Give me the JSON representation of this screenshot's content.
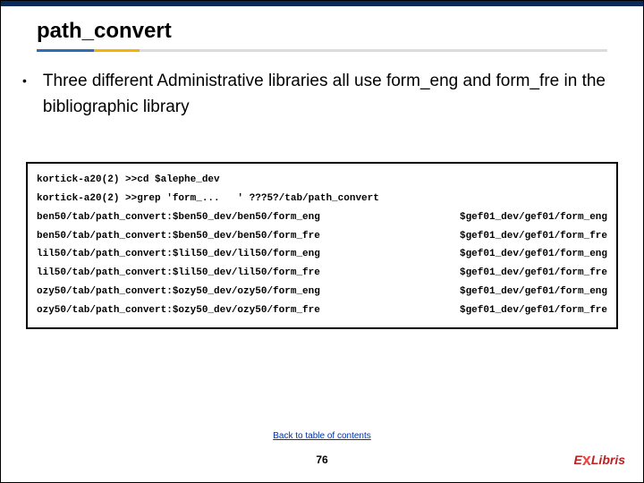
{
  "title": "path_convert",
  "bullet": "Three different Administrative libraries all use form_eng and form_fre in the bibliographic library",
  "code": {
    "rows": [
      {
        "left": "kortick-a20(2) >>cd $alephe_dev",
        "right": ""
      },
      {
        "left": "kortick-a20(2) >>grep 'form_...   ' ???5?/tab/path_convert",
        "right": ""
      },
      {
        "left": "ben50/tab/path_convert:$ben50_dev/ben50/form_eng",
        "right": "$gef01_dev/gef01/form_eng"
      },
      {
        "left": "ben50/tab/path_convert:$ben50_dev/ben50/form_fre",
        "right": "$gef01_dev/gef01/form_fre"
      },
      {
        "left": "lil50/tab/path_convert:$lil50_dev/lil50/form_eng",
        "right": "$gef01_dev/gef01/form_eng"
      },
      {
        "left": "lil50/tab/path_convert:$lil50_dev/lil50/form_fre",
        "right": "$gef01_dev/gef01/form_fre"
      },
      {
        "left": "ozy50/tab/path_convert:$ozy50_dev/ozy50/form_eng",
        "right": "$gef01_dev/gef01/form_eng"
      },
      {
        "left": "ozy50/tab/path_convert:$ozy50_dev/ozy50/form_fre",
        "right": "$gef01_dev/gef01/form_fre"
      }
    ]
  },
  "footer": {
    "link_label": "Back to table of contents",
    "page": "76",
    "logo_prefix": "E",
    "logo_x": "x",
    "logo_suffix": "Libris"
  }
}
